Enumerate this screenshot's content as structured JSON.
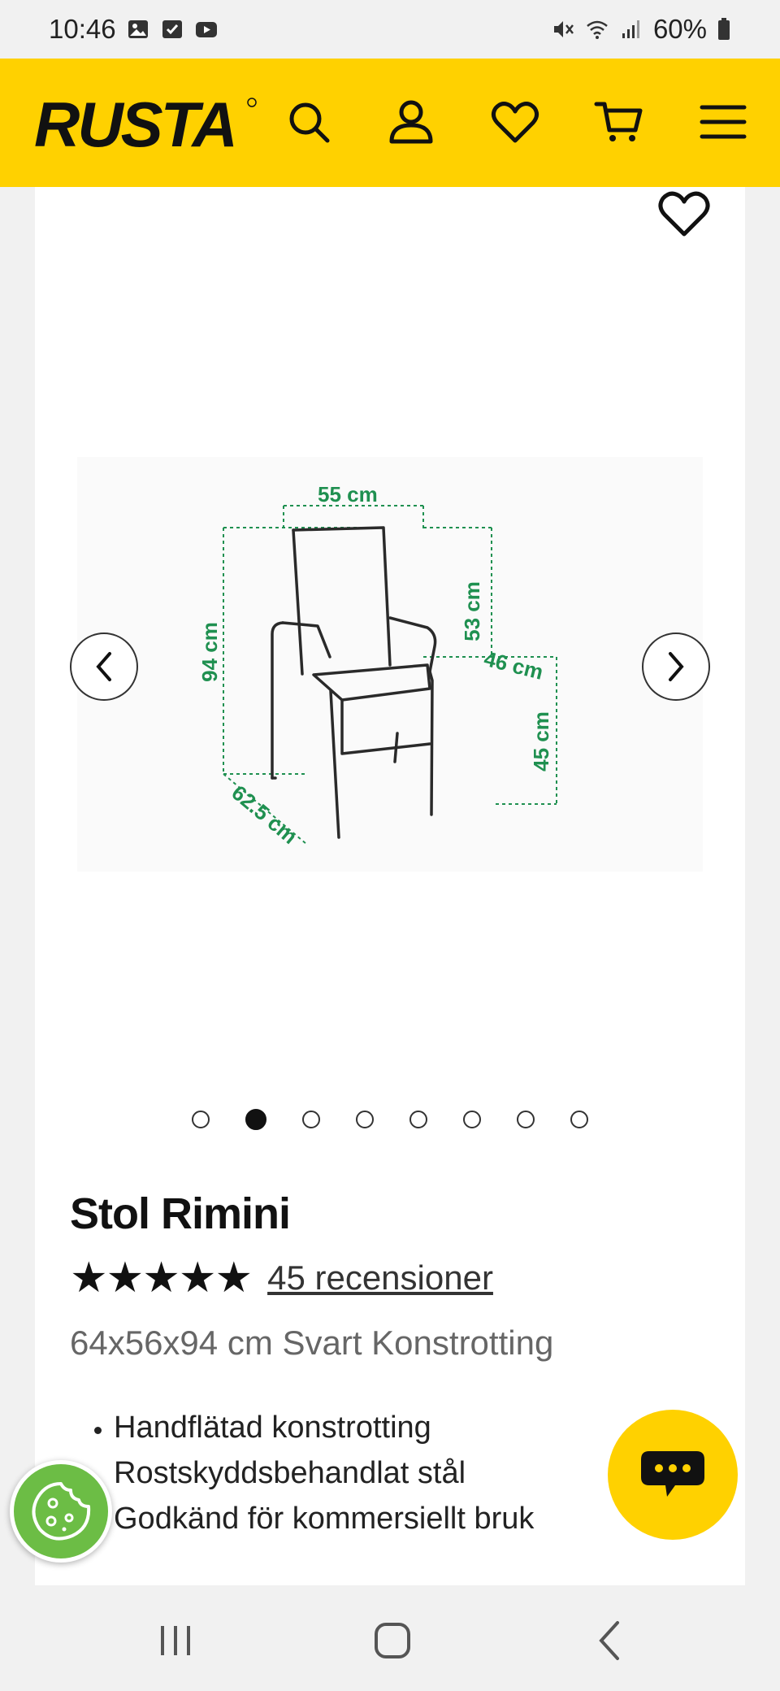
{
  "status": {
    "time": "10:46",
    "battery": "60%"
  },
  "header": {
    "brand": "RUSTA",
    "brand_color": "#ffd100"
  },
  "product": {
    "title": "Stol Rimini",
    "stars": "★★★★★",
    "rating": 4.5,
    "reviews": "45 recensioner",
    "subtitle": "64x56x94 cm Svart Konstrotting",
    "features": [
      "Handflätad konstrotting",
      "Rostskyddsbehandlat stål",
      "Godkänd för kommersiellt bruk"
    ]
  },
  "gallery": {
    "dimensions": {
      "width": "55 cm",
      "back_height": "53 cm",
      "total_height": "94 cm",
      "seat_depth": "46 cm",
      "seat_height": "45 cm",
      "depth": "62.5 cm"
    },
    "slide_count": 8,
    "active_slide": 2
  },
  "icons": {
    "search": "search-icon",
    "account": "user-icon",
    "favorites": "heart-icon",
    "cart": "cart-icon",
    "menu": "menu-icon",
    "chat": "chat-icon",
    "cookie": "cookie-icon"
  }
}
